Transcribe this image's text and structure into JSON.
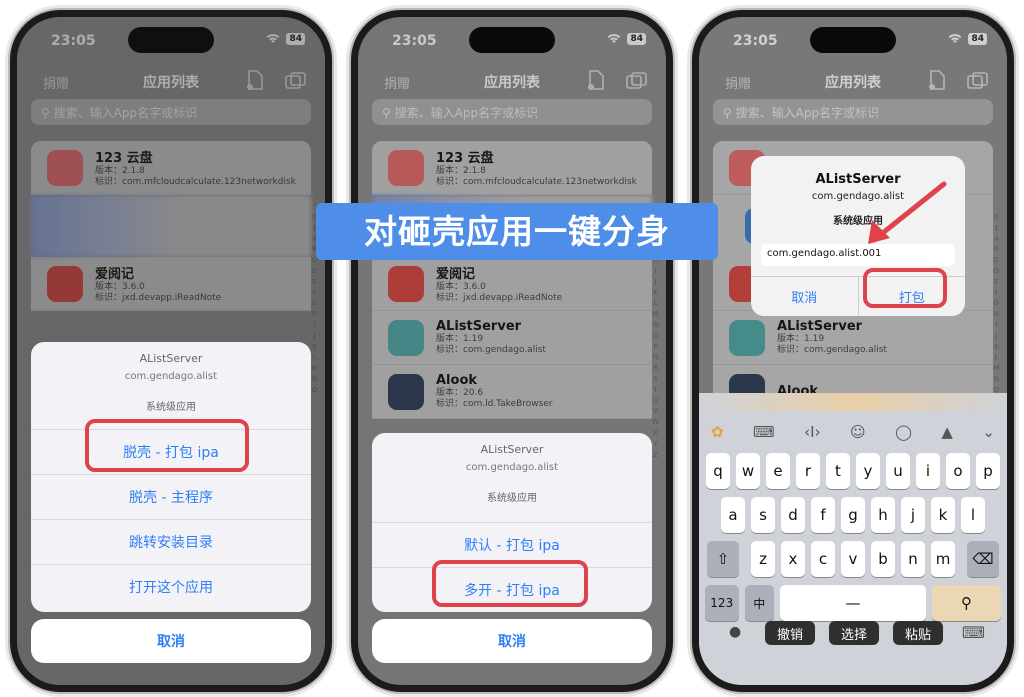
{
  "banner": "对砸壳应用一键分身",
  "status": {
    "time": "23:05",
    "battery": "84"
  },
  "nav": {
    "left": "捐赠",
    "title": "应用列表"
  },
  "search_placeholder": "搜索、输入App名字或标识",
  "apps": [
    {
      "name": "123 云盘",
      "version": "版本：2.1.8",
      "id": "标识：com.mfcloudcalculate.123networkdisk",
      "color": "#e86a6a"
    },
    {
      "name": "爱阅记",
      "version": "版本：3.6.0",
      "id": "标识：jxd.devapp.iReadNote",
      "color": "#d9453f"
    },
    {
      "name": "AListServer",
      "version": "版本：1.19",
      "id": "标识：com.gendago.alist",
      "color": "#4ea7a6"
    },
    {
      "name": "Alook",
      "version": "版本：20.6",
      "id": "标识：com.ld.TakeBrowser",
      "color": "#2c3b58"
    }
  ],
  "index_letters": [
    "0",
    "1",
    "A",
    "B",
    "C",
    "D",
    "E",
    "F",
    "G",
    "H",
    "I",
    "J",
    "K",
    "L",
    "M",
    "N",
    "O",
    "P",
    "Q",
    "R",
    "S",
    "T",
    "U",
    "V",
    "W",
    "X",
    "Y",
    "Z",
    "#"
  ],
  "sheet_header": {
    "app": "AListServer",
    "bundle": "com.gendago.alist",
    "level": "系统级应用"
  },
  "sheet1_options": [
    "脱壳 - 打包 ipa",
    "脱壳 - 主程序",
    "跳转安装目录",
    "打开这个应用"
  ],
  "sheet2_options": [
    "默认 - 打包 ipa",
    "多开 - 打包 ipa"
  ],
  "cancel_label": "取消",
  "alert": {
    "title": "AListServer",
    "bundle": "com.gendago.alist",
    "level": "系统级应用",
    "field_value": "com.gendago.alist.001",
    "cancel": "取消",
    "confirm": "打包"
  },
  "keyboard": {
    "row1": [
      "q",
      "w",
      "e",
      "r",
      "t",
      "y",
      "u",
      "i",
      "o",
      "p"
    ],
    "row2": [
      "a",
      "s",
      "d",
      "f",
      "g",
      "h",
      "j",
      "k",
      "l"
    ],
    "row3": [
      "z",
      "x",
      "c",
      "v",
      "b",
      "n",
      "m"
    ],
    "num_key": "123",
    "lang_key": "中",
    "space": "—",
    "edit_buttons": [
      "撤销",
      "选择",
      "粘贴"
    ]
  },
  "colors": {
    "accent": "#2f7ff5",
    "highlight": "#e0424c",
    "banner": "#4f8ee8"
  }
}
